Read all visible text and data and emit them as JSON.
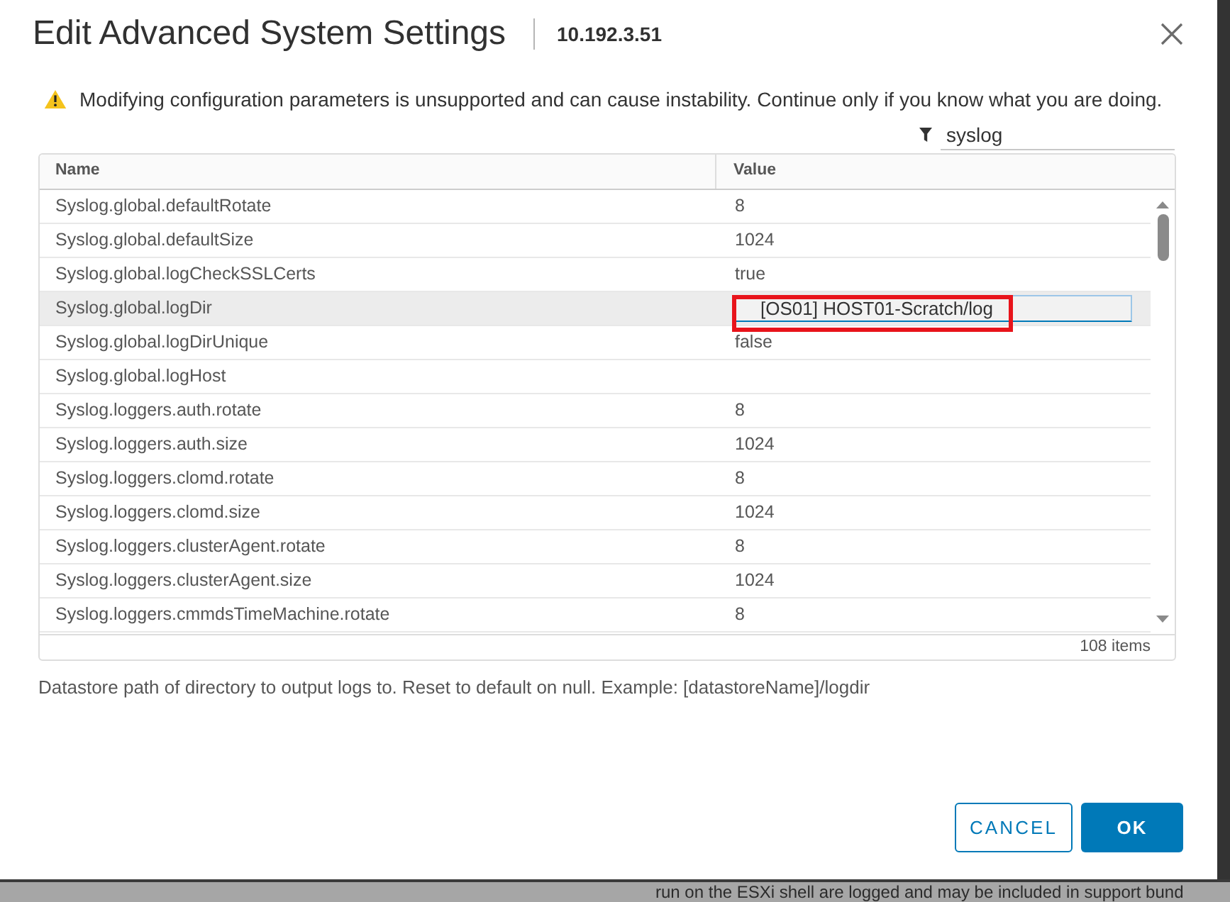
{
  "dialog": {
    "title": "Edit Advanced System Settings",
    "subtitle": "10.192.3.51"
  },
  "warning": {
    "text": "Modifying configuration parameters is unsupported and can cause instability. Continue only if you know what you are doing."
  },
  "filter": {
    "value": "syslog"
  },
  "table": {
    "columns": [
      "Name",
      "Value"
    ],
    "rows": [
      {
        "name": "Syslog.global.defaultRotate",
        "value": "8",
        "selected": false,
        "editing": false,
        "highlighted": false
      },
      {
        "name": "Syslog.global.defaultSize",
        "value": "1024",
        "selected": false,
        "editing": false,
        "highlighted": false
      },
      {
        "name": "Syslog.global.logCheckSSLCerts",
        "value": "true",
        "selected": false,
        "editing": false,
        "highlighted": false
      },
      {
        "name": "Syslog.global.logDir",
        "value": "[OS01] HOST01-Scratch/log",
        "selected": true,
        "editing": true,
        "highlighted": true
      },
      {
        "name": "Syslog.global.logDirUnique",
        "value": "false",
        "selected": false,
        "editing": false,
        "highlighted": false
      },
      {
        "name": "Syslog.global.logHost",
        "selected": false,
        "editing": false,
        "highlighted": false
      },
      {
        "name": "Syslog.loggers.auth.rotate",
        "value": "8",
        "selected": false,
        "editing": false,
        "highlighted": false
      },
      {
        "name": "Syslog.loggers.auth.size",
        "value": "1024",
        "selected": false,
        "editing": false,
        "highlighted": false
      },
      {
        "name": "Syslog.loggers.clomd.rotate",
        "value": "8",
        "selected": false,
        "editing": false,
        "highlighted": false
      },
      {
        "name": "Syslog.loggers.clomd.size",
        "value": "1024",
        "selected": false,
        "editing": false,
        "highlighted": false
      },
      {
        "name": "Syslog.loggers.clusterAgent.rotate",
        "value": "8",
        "selected": false,
        "editing": false,
        "highlighted": false
      },
      {
        "name": "Syslog.loggers.clusterAgent.size",
        "value": "1024",
        "selected": false,
        "editing": false,
        "highlighted": false
      },
      {
        "name": "Syslog.loggers.cmmdsTimeMachine.rotate",
        "value": "8",
        "selected": false,
        "editing": false,
        "highlighted": false
      }
    ],
    "footer": "108 items"
  },
  "description": "Datastore path of directory to output logs to. Reset to default on null. Example: [datastoreName]/logdir",
  "buttons": [
    {
      "label": "CANCEL",
      "kind": "secondary"
    },
    {
      "label": "OK",
      "kind": "primary"
    }
  ],
  "background_text": "run on the ESXi shell are logged and may be included in support bund"
}
